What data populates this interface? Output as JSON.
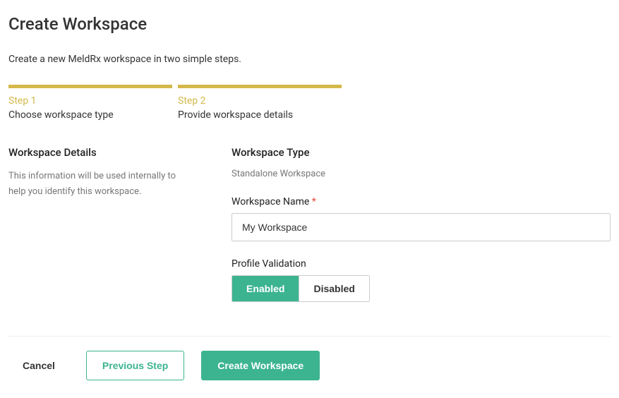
{
  "header": {
    "title": "Create Workspace",
    "subtitle": "Create a new MeldRx workspace in two simple steps."
  },
  "steps": [
    {
      "number": "Step 1",
      "label": "Choose workspace type"
    },
    {
      "number": "Step 2",
      "label": "Provide workspace details"
    }
  ],
  "details": {
    "section_title": "Workspace Details",
    "section_desc": "This information will be used internally to help you identify this workspace."
  },
  "form": {
    "type_label": "Workspace Type",
    "type_value": "Standalone Workspace",
    "name_label": "Workspace Name",
    "name_value": "My Workspace",
    "validation_label": "Profile Validation",
    "validation_enabled": "Enabled",
    "validation_disabled": "Disabled"
  },
  "actions": {
    "cancel": "Cancel",
    "previous": "Previous Step",
    "submit": "Create Workspace"
  }
}
